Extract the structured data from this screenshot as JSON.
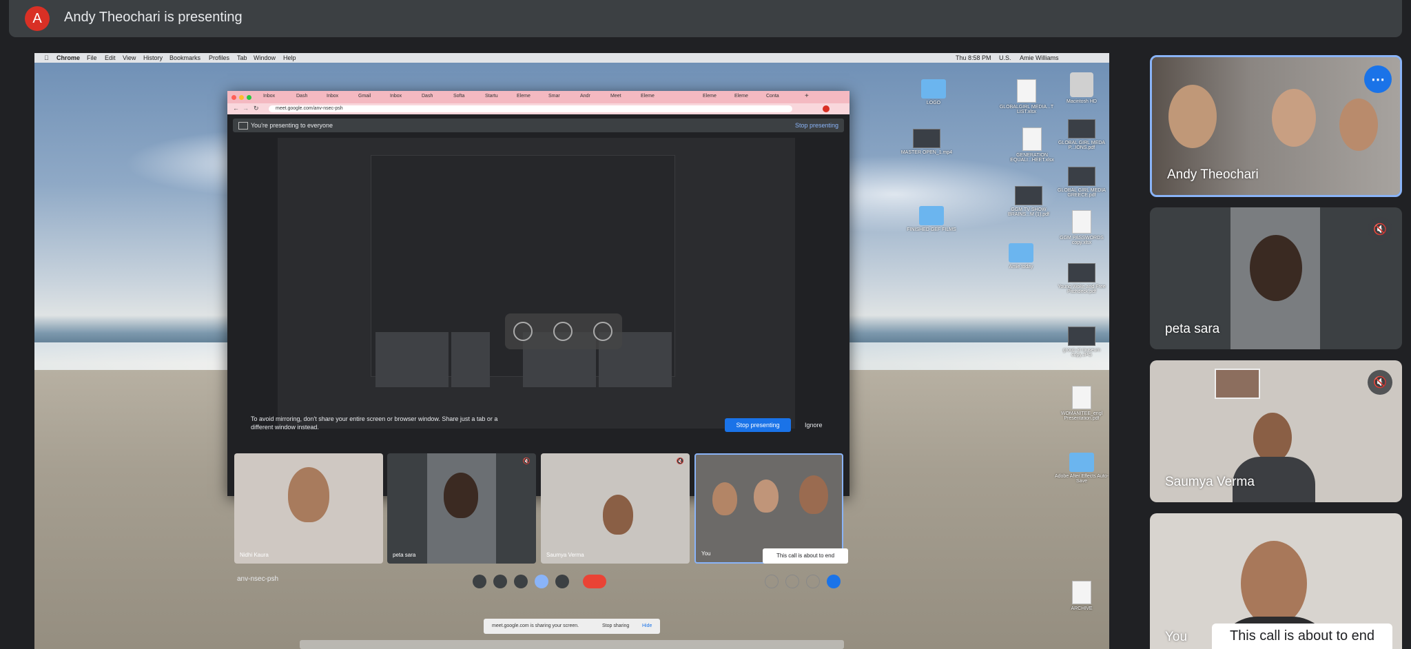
{
  "banner": {
    "avatar_letter": "A",
    "title": "Andy Theochari is presenting"
  },
  "mac_menubar": {
    "app": "Chrome",
    "items": [
      "File",
      "Edit",
      "View",
      "History",
      "Bookmarks",
      "Profiles",
      "Tab",
      "Window",
      "Help"
    ],
    "clock": "Thu 8:58 PM",
    "region": "U.S.",
    "user": "Amie Williams"
  },
  "desktop_icons": [
    {
      "label": "LOGO",
      "kind": "folder"
    },
    {
      "label": "GLOBALGIRL MEDIA...T LIST.xlsx",
      "kind": "file"
    },
    {
      "label": "Macintosh HD",
      "kind": "disk"
    },
    {
      "label": "MASTER OPEN_1.mp4",
      "kind": "img"
    },
    {
      "label": "GENERATION EQUALI...HEET.xlsx",
      "kind": "file"
    },
    {
      "label": "GLOBAL GIRL MEDA P...IONS.pdf",
      "kind": "file"
    },
    {
      "label": "GLOBAL GIRL MEDIA GREECE.pdf",
      "kind": "file"
    },
    {
      "label": "GGM TV SHOW BRAINS...M (1).pdf",
      "kind": "file"
    },
    {
      "label": "FINISHED GEF FILMS",
      "kind": "folder"
    },
    {
      "label": "GGM PASSWORDS copy.xlsx",
      "kind": "file"
    },
    {
      "label": "Amie today",
      "kind": "folder"
    },
    {
      "label": "Young Woke and Free Pitchdeck.pdf",
      "kind": "img"
    },
    {
      "label": "group at museum copy.JPG",
      "kind": "img"
    },
    {
      "label": "WOMANITEE_engl Presentation.pdf",
      "kind": "file"
    },
    {
      "label": "Adobe After Effects Auto-Save",
      "kind": "folder"
    },
    {
      "label": "ARCHIVE",
      "kind": "file"
    }
  ],
  "browser": {
    "tabs": [
      "Inbox",
      "Dash",
      "Inbox",
      "Gmail",
      "Inbox",
      "Dash",
      "Softa",
      "Startu",
      "Eleme",
      "Smar",
      "Andr",
      "Meet",
      "Eleme",
      "",
      "Eleme",
      "Eleme",
      "Conta"
    ],
    "url": "meet.google.com/anv-nsec-psh"
  },
  "meet": {
    "present_banner": "You're presenting to everyone",
    "stop_presenting_link": "Stop presenting",
    "warning": "To avoid mirroring, don't share your entire screen or browser window. Share just a tab or a different window instead.",
    "stop_presenting_button": "Stop presenting",
    "ignore": "Ignore",
    "participants": [
      {
        "name": "Nidhi Kaura",
        "muted": false
      },
      {
        "name": "peta sara",
        "muted": true
      },
      {
        "name": "Saumya Verma",
        "muted": true
      },
      {
        "name": "You",
        "muted": false
      }
    ],
    "meeting_code": "anv-nsec-psh",
    "tooltip": "This call is about to end",
    "sharing_note": "meet.google.com is sharing your screen.",
    "stop_sharing": "Stop sharing",
    "hide": "Hide"
  },
  "sidebar": {
    "tiles": [
      {
        "name": "Andy Theochari",
        "muted": false,
        "active": true
      },
      {
        "name": "peta sara",
        "muted": true,
        "active": false
      },
      {
        "name": "Saumya Verma",
        "muted": true,
        "active": false
      },
      {
        "name": "You",
        "muted": false,
        "active": false
      }
    ],
    "tooltip": "This call is about to end"
  },
  "colors": {
    "accent": "#1a73e8",
    "end_call": "#ea4335",
    "avatar": "#d93025",
    "banner_bg": "#3c4043",
    "page_bg": "#202124"
  }
}
